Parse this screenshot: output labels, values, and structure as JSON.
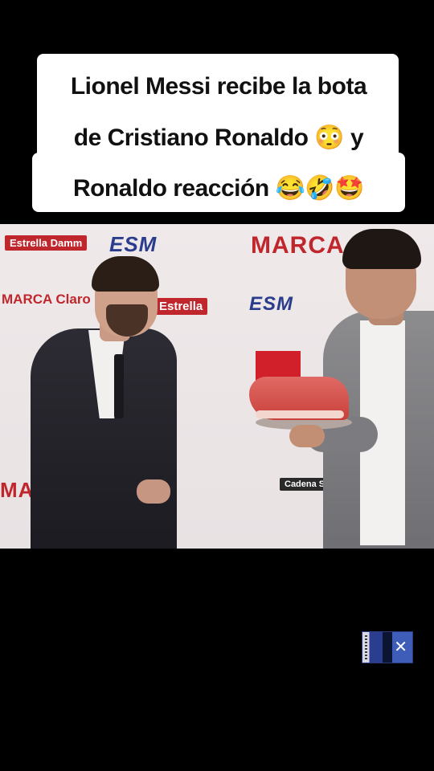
{
  "caption": {
    "line1": "Lionel Messi recibe la bota",
    "line2": "de Cristiano Ronaldo 😳 y",
    "line3": "Ronaldo reacción 😂🤣🤩"
  },
  "video": {
    "backdrop_logos": [
      "Estrella Damm",
      "ESM",
      "MARCA",
      "MARCA Claro",
      "Estrella",
      "MARCA",
      "Cadena SER"
    ],
    "colors": {
      "brand_red": "#c0272d",
      "esm_blue": "#2a3c8c"
    }
  },
  "watermark": {
    "icon": "tv-channel-logo"
  }
}
